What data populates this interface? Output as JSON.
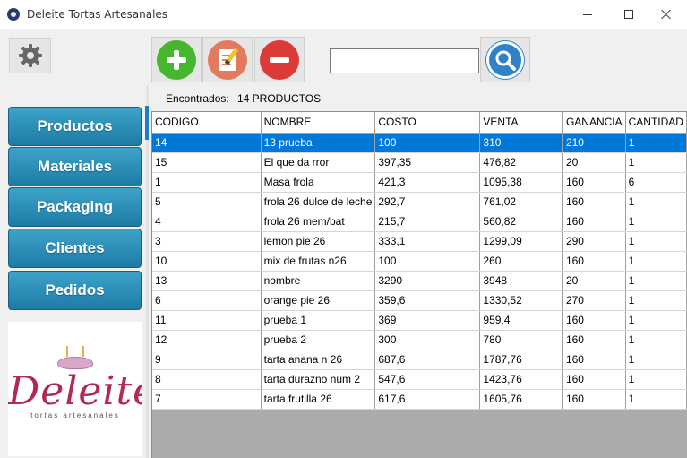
{
  "window": {
    "title": "Deleite Tortas Artesanales"
  },
  "toolbar": {
    "settings_icon": "gear-icon",
    "add_icon": "plus-circle-icon",
    "edit_icon": "edit-document-icon",
    "remove_icon": "minus-circle-icon",
    "search_icon": "magnifier-icon",
    "search_value": "",
    "colors": {
      "add": "#46b62e",
      "edit": "#e27a5e",
      "remove": "#dc3a37",
      "search": "#2f82c9"
    }
  },
  "sidebar": {
    "items": [
      {
        "label": "Productos"
      },
      {
        "label": "Materiales"
      },
      {
        "label": "Packaging"
      },
      {
        "label": "Clientes"
      },
      {
        "label": "Pedidos"
      }
    ],
    "logo": {
      "text": "Deleite",
      "subtitle": "tortas artesanales"
    },
    "accent_color": "#1d7ba5"
  },
  "main": {
    "found_label": "Encontrados:",
    "found_count": "14 PRODUCTOS",
    "table": {
      "columns": [
        "CODIGO",
        "NOMBRE",
        "COSTO",
        "VENTA",
        "GANANCIA",
        "CANTIDAD"
      ],
      "rows": [
        [
          "14",
          "13 prueba",
          "100",
          "310",
          "210",
          "1"
        ],
        [
          "15",
          "El que da rror",
          "397,35",
          "476,82",
          "20",
          "1"
        ],
        [
          "1",
          "Masa frola",
          "421,3",
          "1095,38",
          "160",
          "6"
        ],
        [
          "5",
          "frola 26 dulce de leche",
          "292,7",
          "761,02",
          "160",
          "1"
        ],
        [
          "4",
          "frola 26 mem/bat",
          "215,7",
          "560,82",
          "160",
          "1"
        ],
        [
          "3",
          "lemon pie 26",
          "333,1",
          "1299,09",
          "290",
          "1"
        ],
        [
          "10",
          "mix de frutas n26",
          "100",
          "260",
          "160",
          "1"
        ],
        [
          "13",
          "nombre",
          "3290",
          "3948",
          "20",
          "1"
        ],
        [
          "6",
          "orange pie 26",
          "359,6",
          "1330,52",
          "270",
          "1"
        ],
        [
          "11",
          "prueba 1",
          "369",
          "959,4",
          "160",
          "1"
        ],
        [
          "12",
          "prueba 2",
          "300",
          "780",
          "160",
          "1"
        ],
        [
          "9",
          "tarta anana n 26",
          "687,6",
          "1787,76",
          "160",
          "1"
        ],
        [
          "8",
          "tarta durazno num 2",
          "547,6",
          "1423,76",
          "160",
          "1"
        ],
        [
          "7",
          "tarta frutilla 26",
          "617,6",
          "1605,76",
          "160",
          "1"
        ]
      ],
      "selected_row": 0,
      "selected_color": "#0078d7"
    }
  }
}
